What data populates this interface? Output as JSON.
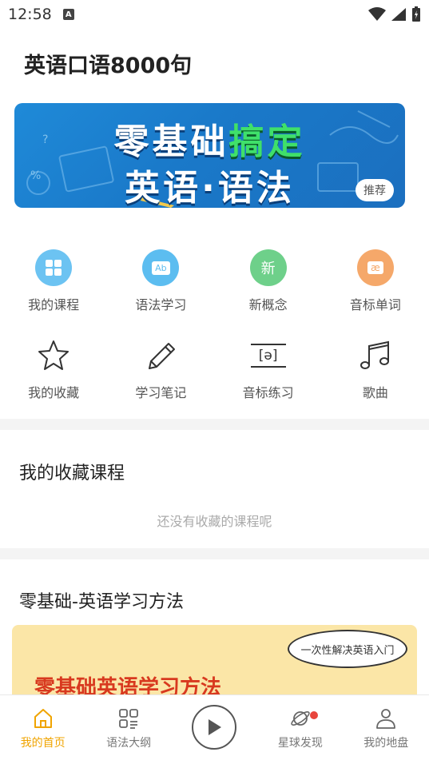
{
  "status": {
    "time": "12:58",
    "notif_letter": "A"
  },
  "app_title": "英语口语8000句",
  "banner": {
    "line1_white": "零基础",
    "line1_green": "搞定",
    "line2": "英语·语法",
    "badge": "推荐"
  },
  "grid": [
    {
      "label": "我的课程",
      "icon": "grid-icon",
      "color": "#6cc3f2"
    },
    {
      "label": "语法学习",
      "icon": "ab-icon",
      "color": "#5cbdf0",
      "glyph": "Ab"
    },
    {
      "label": "新概念",
      "icon": "xin-icon",
      "color": "#6ed08a",
      "glyph": "新"
    },
    {
      "label": "音标单词",
      "icon": "ae-icon",
      "color": "#f5a86a",
      "glyph": "æ"
    },
    {
      "label": "我的收藏",
      "icon": "star-icon"
    },
    {
      "label": "学习笔记",
      "icon": "pencil-icon"
    },
    {
      "label": "音标练习",
      "icon": "phonetic-icon",
      "glyph": "[ə]"
    },
    {
      "label": "歌曲",
      "icon": "music-icon"
    }
  ],
  "favorites": {
    "title": "我的收藏课程",
    "empty": "还没有收藏的课程呢"
  },
  "methods": {
    "title": "零基础-英语学习方法",
    "promo_title": "零基础英语学习方法",
    "promo_bubble": "一次性解决英语入门"
  },
  "tabbar": [
    {
      "label": "我的首页",
      "active": true
    },
    {
      "label": "语法大纲",
      "active": false
    },
    {
      "label": "",
      "active": false
    },
    {
      "label": "星球发现",
      "active": false
    },
    {
      "label": "我的地盘",
      "active": false
    }
  ],
  "colors": {
    "accent": "#f0a400",
    "badge_dot": "#e8453c",
    "banner_green": "#3fe06a"
  }
}
